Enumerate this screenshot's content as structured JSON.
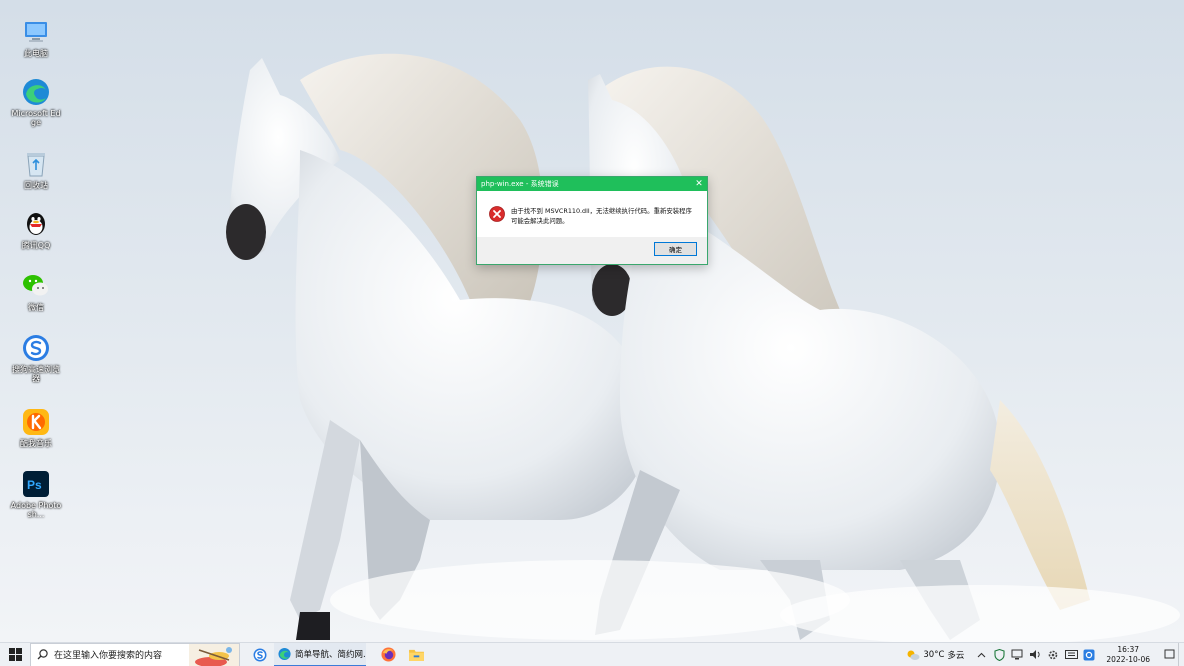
{
  "desktop": {
    "icons": [
      {
        "label": "此电脑",
        "icon": "computer-icon"
      },
      {
        "label": "Microsoft Edge",
        "icon": "edge-icon"
      },
      {
        "label": "回收站",
        "icon": "recycle-bin-icon"
      },
      {
        "label": "腾讯QQ",
        "icon": "qq-icon"
      },
      {
        "label": "微信",
        "icon": "wechat-icon"
      },
      {
        "label": "搜狗高速浏览器",
        "icon": "sogou-browser-icon"
      },
      {
        "label": "酷我音乐",
        "icon": "kuwo-music-icon"
      },
      {
        "label": "Adobe Photosh...",
        "icon": "photoshop-icon"
      }
    ]
  },
  "dialog": {
    "title": "php-win.exe - 系统错误",
    "close_glyph": "✕",
    "message": "由于找不到 MSVCR110.dll，无法继续执行代码。重新安装程序可能会解决此问题。",
    "ok_label": "确定",
    "titlebar_color": "#1fbf5b"
  },
  "taskbar": {
    "search_placeholder": "在这里输入你要搜索的内容",
    "browser_task_label": "简单导航、简约网...",
    "weather_temp": "30°C",
    "weather_desc": "多云",
    "time": "16:37",
    "date": "2022-10-06",
    "accent": "#3b7cd8"
  }
}
